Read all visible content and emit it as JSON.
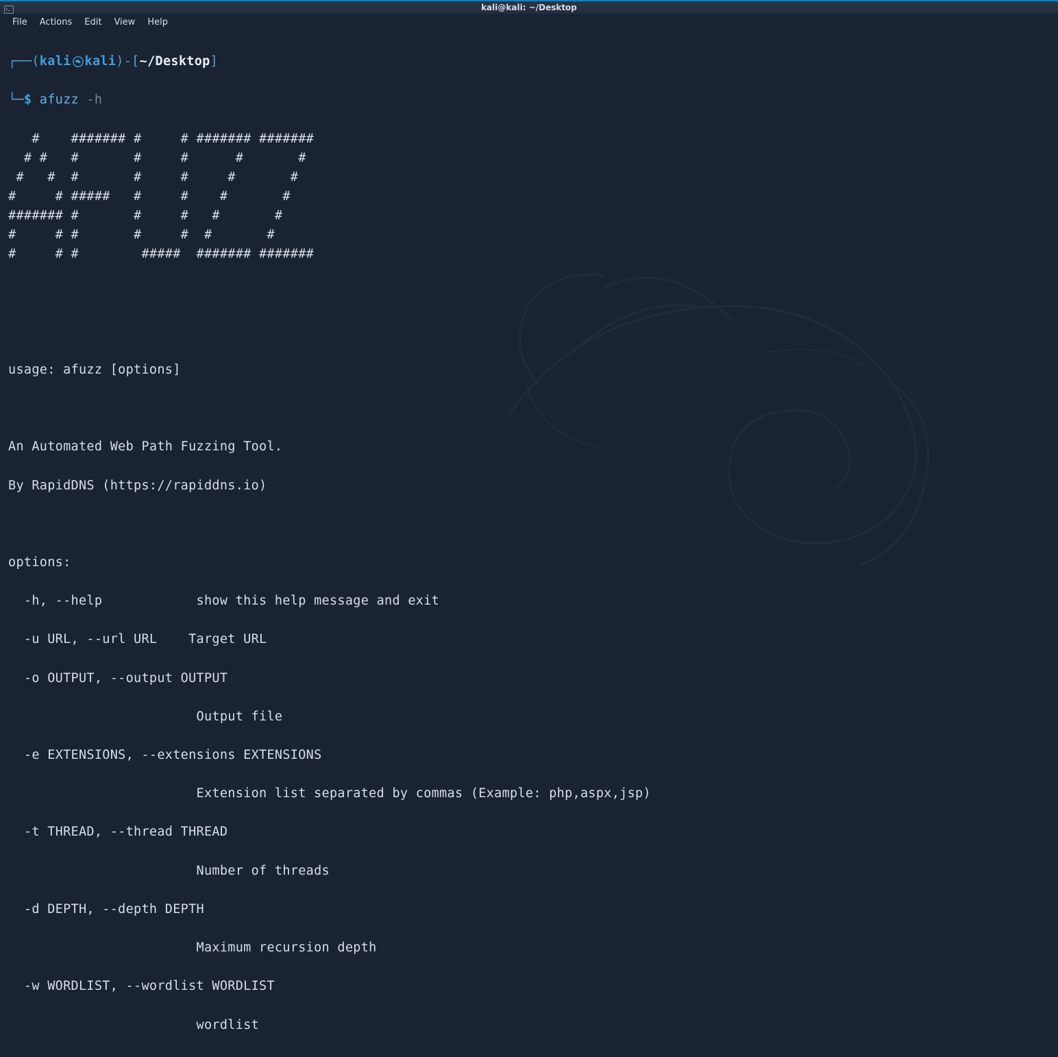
{
  "titlebar": {
    "title": "kali@kali: ~/Desktop"
  },
  "menubar": {
    "items": [
      "File",
      "Actions",
      "Edit",
      "View",
      "Help"
    ]
  },
  "prompt": {
    "user": "kali",
    "host": "kali",
    "path": "~/Desktop",
    "command": "afuzz",
    "args": "-h"
  },
  "output": {
    "ascii_art": "   #    ####### #     # ####### #######\n  # #   #       #     #      #       # \n #   #  #       #     #     #       #  \n#     # #####   #     #    #       #   \n####### #       #     #   #       #    \n#     # #       #     #  #       #     \n#     # #        #####  ####### #######",
    "usage": "usage: afuzz [options]",
    "description": "An Automated Web Path Fuzzing Tool.",
    "author": "By RapidDNS (https://rapiddns.io)",
    "options_header": "options:",
    "options": [
      {
        "flag": "  -h, --help            ",
        "desc": "show this help message and exit"
      },
      {
        "flag": "  -u URL, --url URL    ",
        "desc": "Target URL"
      },
      {
        "flag": "  -o OUTPUT, --output OUTPUT",
        "desc": ""
      },
      {
        "flag": "                        ",
        "desc": "Output file"
      },
      {
        "flag": "  -e EXTENSIONS, --extensions EXTENSIONS",
        "desc": ""
      },
      {
        "flag": "                        ",
        "desc": "Extension list separated by commas (Example: php,aspx,jsp)"
      },
      {
        "flag": "  -t THREAD, --thread THREAD",
        "desc": ""
      },
      {
        "flag": "                        ",
        "desc": "Number of threads"
      },
      {
        "flag": "  -d DEPTH, --depth DEPTH",
        "desc": ""
      },
      {
        "flag": "                        ",
        "desc": "Maximum recursion depth"
      },
      {
        "flag": "  -w WORDLIST, --wordlist WORDLIST",
        "desc": ""
      },
      {
        "flag": "                        ",
        "desc": "wordlist"
      }
    ]
  }
}
